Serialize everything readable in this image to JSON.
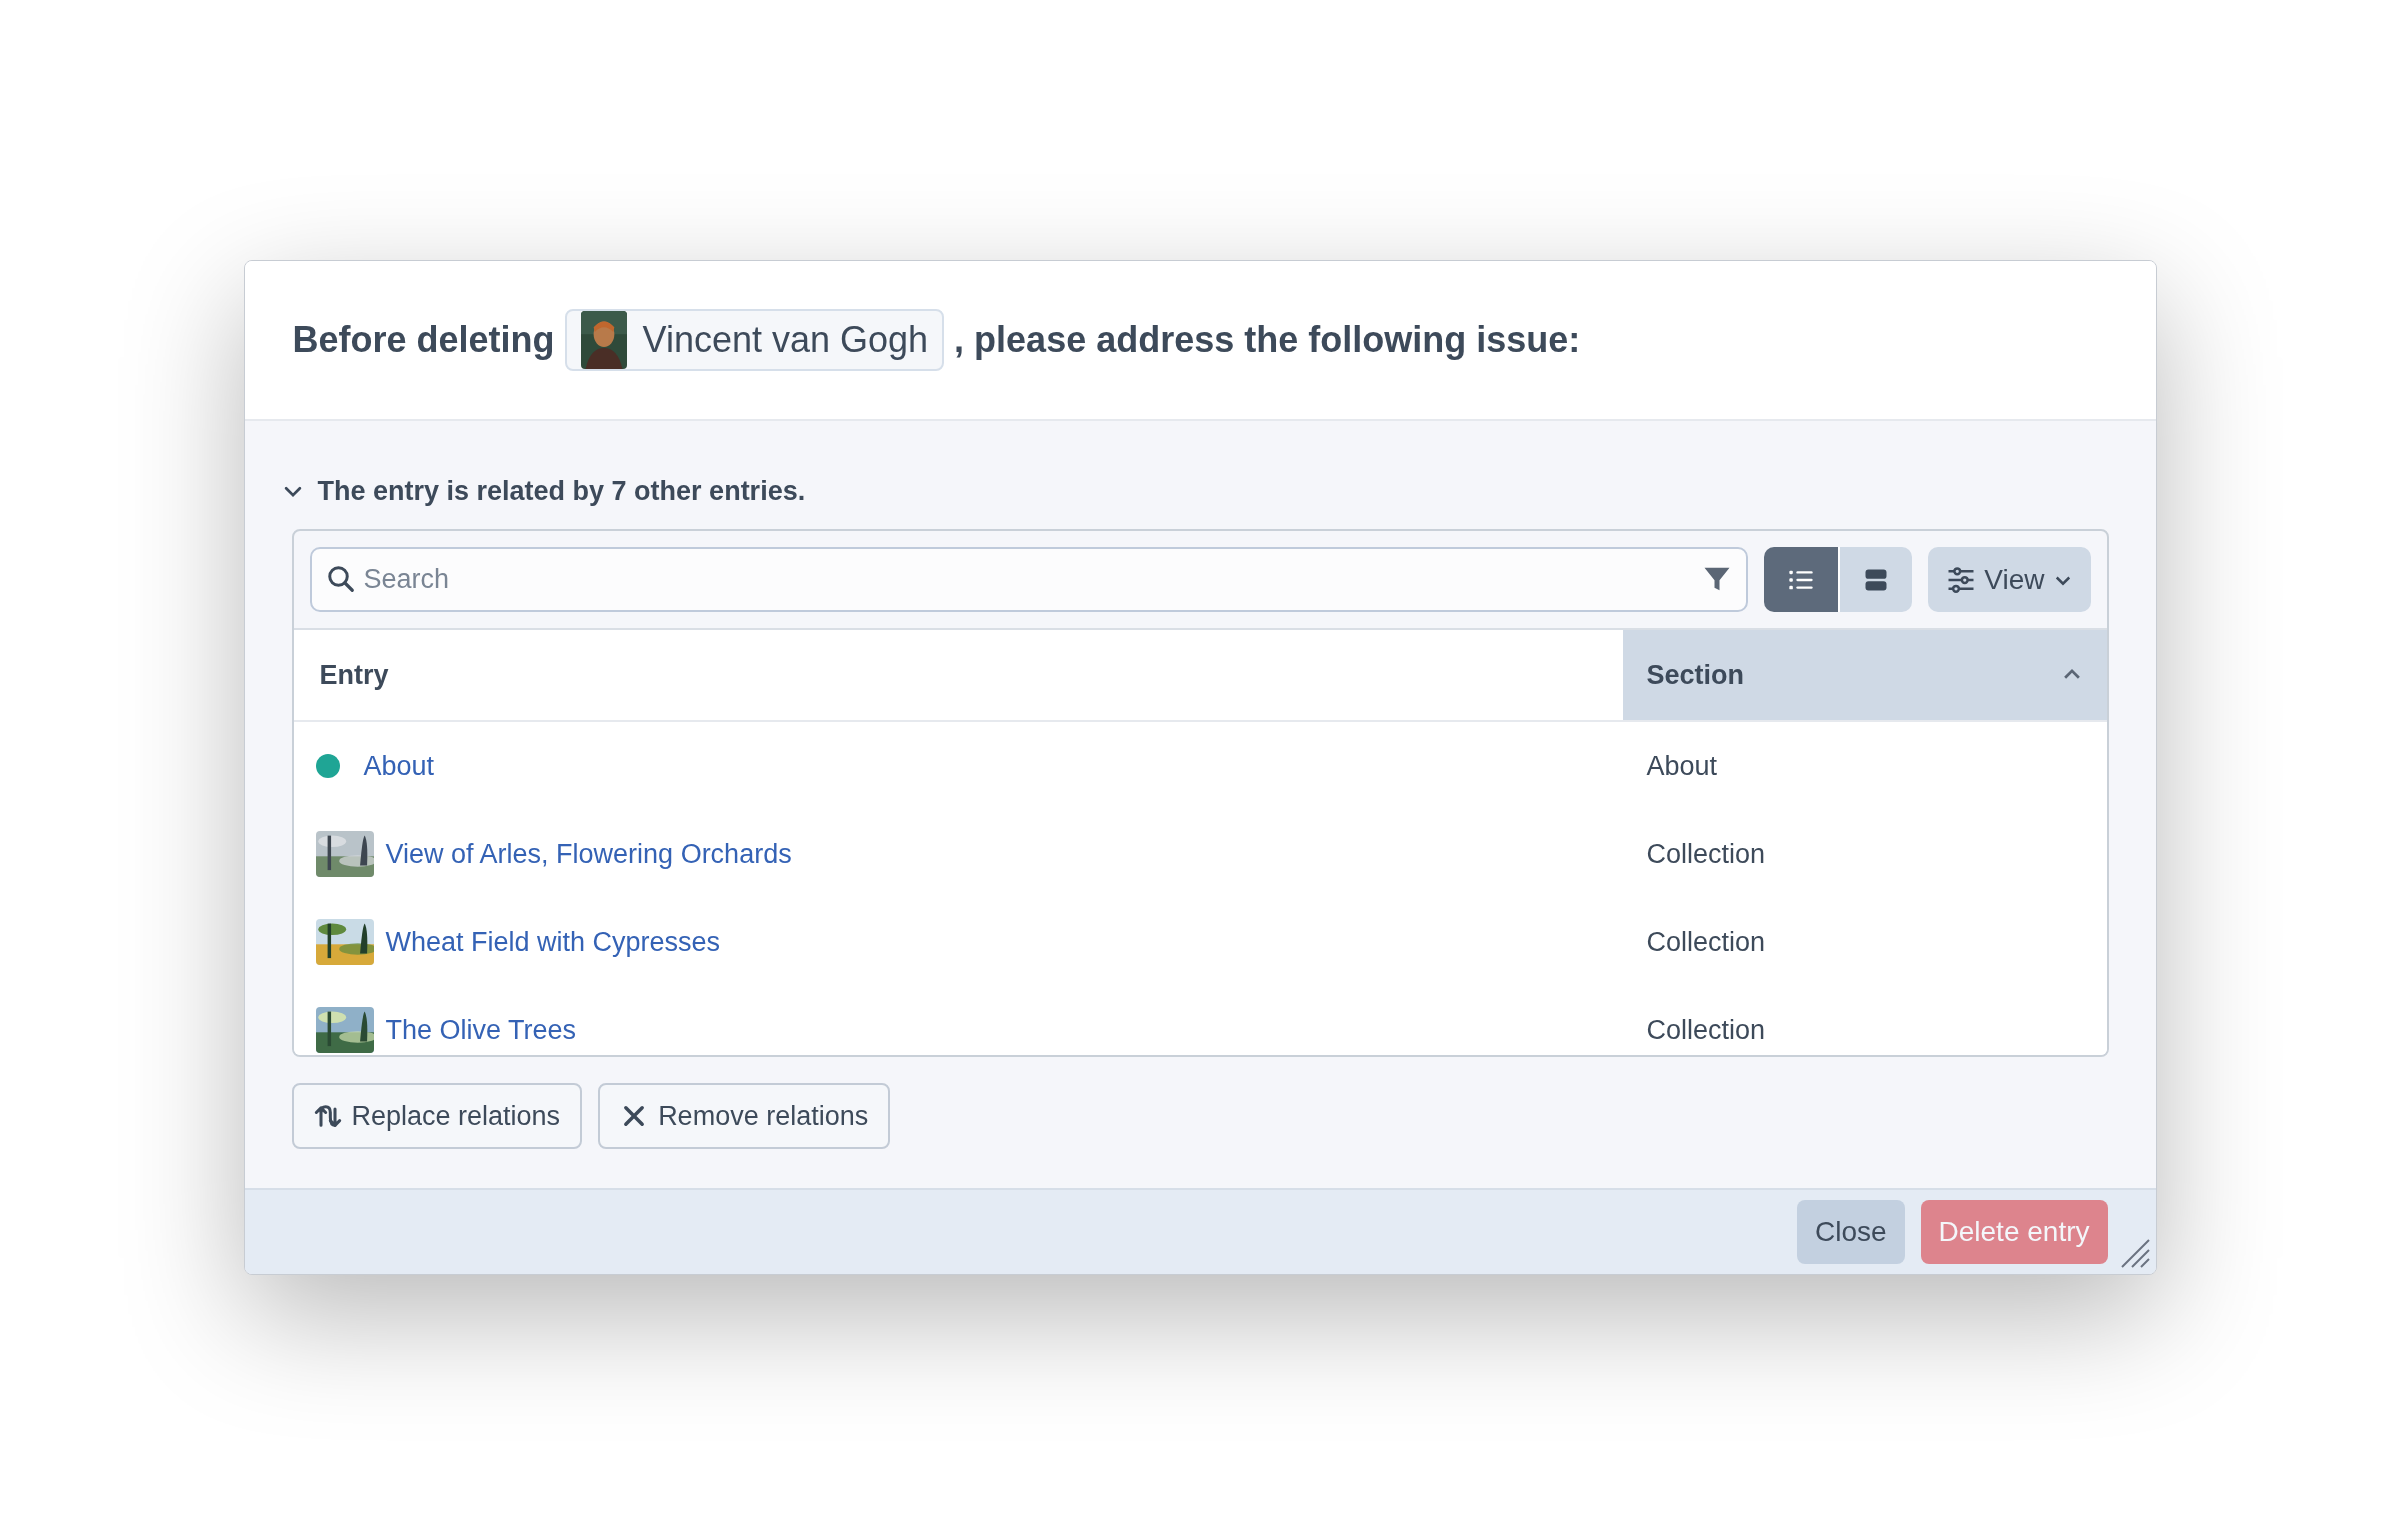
{
  "dialog": {
    "title_before": "Before deleting",
    "entry_chip": {
      "label": "Vincent van Gogh",
      "kind": "picture"
    },
    "title_after": ", please address the following issue:"
  },
  "issue": {
    "expanded": true,
    "text": "The entry is related by 7 other entries."
  },
  "search": {
    "placeholder": "Search"
  },
  "view_toggle": [
    {
      "kind": "list",
      "selected": true
    },
    {
      "kind": "cards",
      "selected": false
    }
  ],
  "view_button": "View",
  "table": {
    "columns": [
      {
        "label": "Entry",
        "sorted": false
      },
      {
        "label": "Section",
        "sorted": true
      }
    ],
    "rows": [
      {
        "kind": "dot",
        "color": "#1fa595",
        "entry": "About",
        "section": "About"
      },
      {
        "kind": "picture",
        "entry": "View of Arles, Flowering Orchards",
        "section": "Collection"
      },
      {
        "kind": "picture",
        "entry": "Wheat Field with Cypresses",
        "section": "Collection"
      },
      {
        "kind": "picture",
        "entry": "The Olive Trees",
        "section": "Collection"
      }
    ]
  },
  "actions": [
    {
      "kind": "replace",
      "label": "Replace relations"
    },
    {
      "kind": "remove",
      "label": "Remove relations"
    }
  ],
  "footer": {
    "buttons": [
      {
        "kind": "secondary",
        "label": "Close",
        "disabled": false
      },
      {
        "kind": "danger",
        "label": "Delete entry",
        "disabled": true
      }
    ]
  }
}
